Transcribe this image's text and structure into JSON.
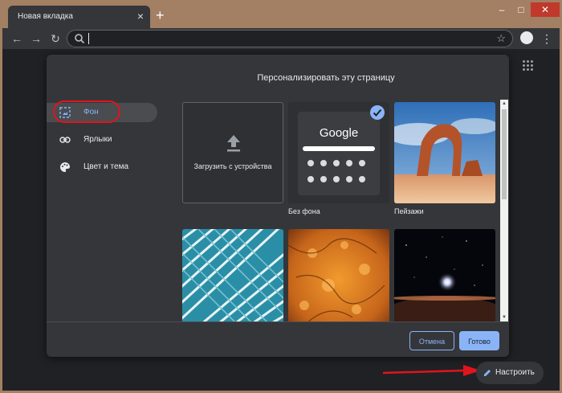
{
  "tab": {
    "title": "Новая вкладка",
    "close": "×",
    "new_tab": "+"
  },
  "window_controls": {
    "minimize": "–",
    "maximize": "□",
    "close": "✕"
  },
  "toolbar": {
    "back": "←",
    "forward": "→",
    "reload": "↻",
    "star": "☆",
    "menu": "⋮",
    "omnibox_value": ""
  },
  "dialog": {
    "title": "Персонализировать эту страницу",
    "sidebar": [
      {
        "label": "Фон",
        "icon": "background-icon",
        "active": true
      },
      {
        "label": "Ярлыки",
        "icon": "link-icon",
        "active": false
      },
      {
        "label": "Цвет и тема",
        "icon": "palette-icon",
        "active": false
      }
    ],
    "tiles": [
      {
        "label": "Загрузить с устройства",
        "icon": "upload-icon",
        "kind": "upload"
      },
      {
        "label": "Без фона",
        "kind": "no-background",
        "logo_text": "Google",
        "selected": true
      },
      {
        "label": "Пейзажи",
        "kind": "landscape"
      },
      {
        "label": "",
        "kind": "architecture"
      },
      {
        "label": "",
        "kind": "texture"
      },
      {
        "label": "",
        "kind": "space"
      }
    ],
    "cancel_label": "Отмена",
    "done_label": "Готово"
  },
  "customize": {
    "label": "Настроить",
    "icon": "pencil-icon"
  },
  "colors": {
    "accent": "#8ab4f8",
    "annotation_red": "#e0141e",
    "background": "#202124",
    "dialog": "#35363a"
  }
}
